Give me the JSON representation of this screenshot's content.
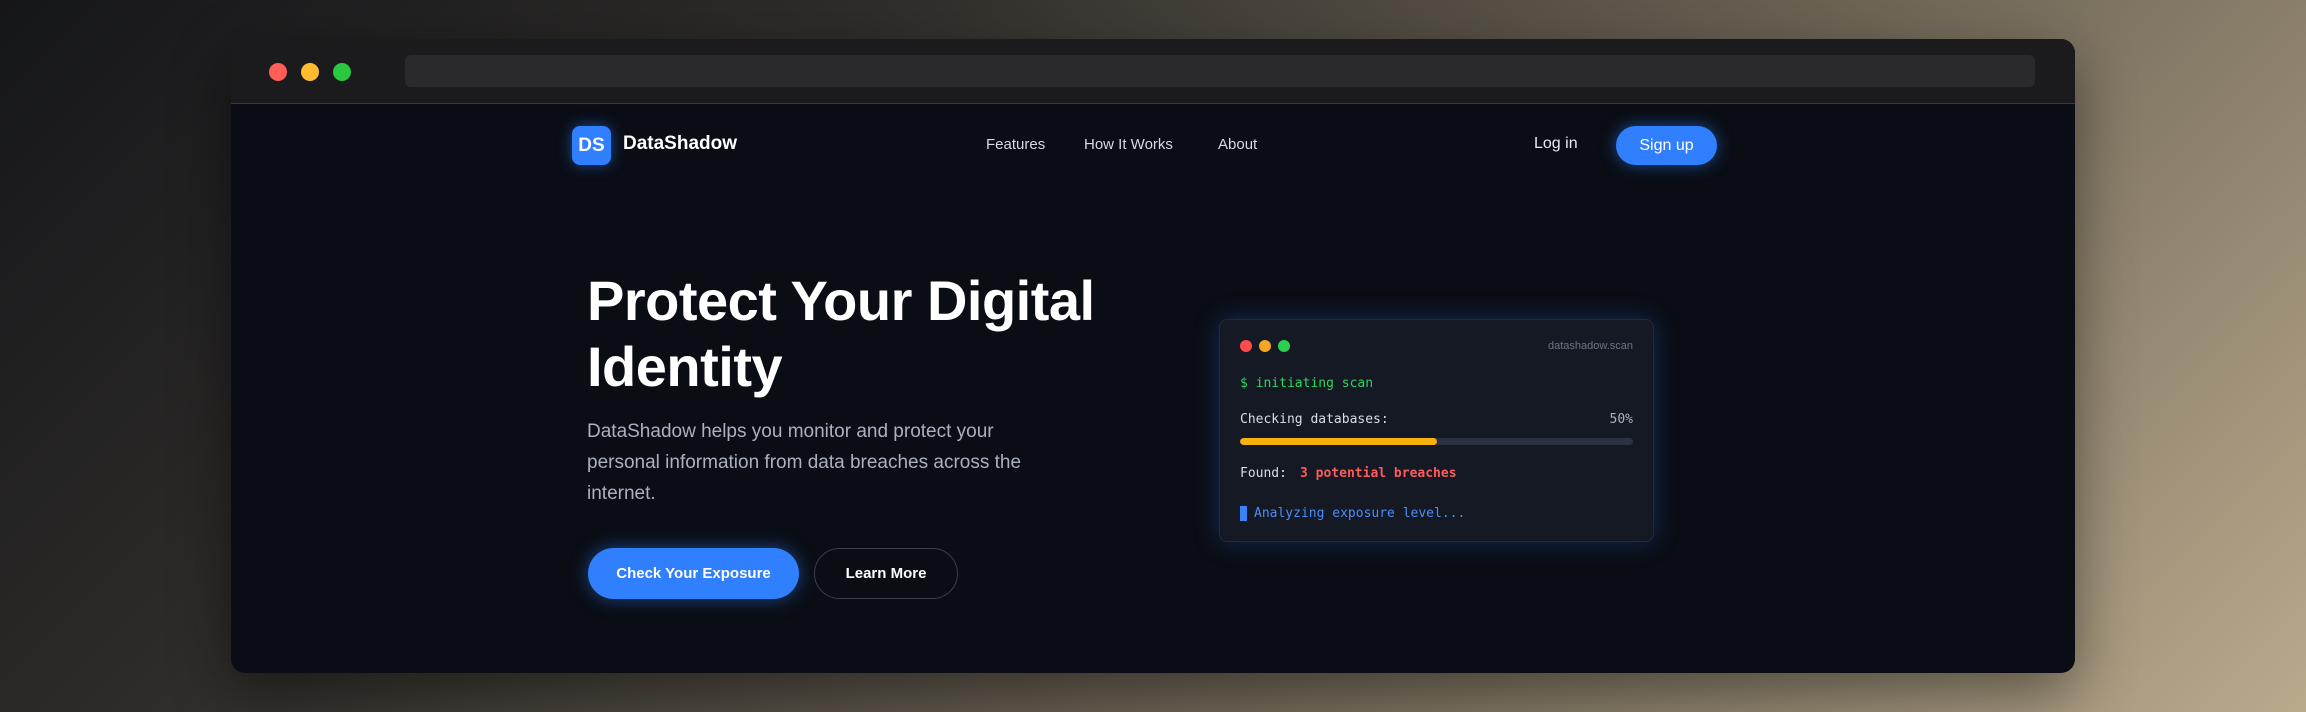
{
  "nav": {
    "logo_text": "DS",
    "brand": "DataShadow",
    "links": [
      "Features",
      "How It Works",
      "About"
    ],
    "login": "Log in",
    "signup": "Sign up"
  },
  "hero": {
    "title": "Protect Your Digital Identity",
    "description": "DataShadow helps you monitor and protect your personal information from data breaches across the internet.",
    "primary_button": "Check Your Exposure",
    "secondary_button": "Learn More"
  },
  "terminal": {
    "title": "datashadow.scan",
    "command": "$ initiating scan",
    "checking_label": "Checking databases:",
    "progress_text": "50%",
    "progress": 0.5,
    "found_label": "Found:",
    "found_value": "3 potential breaches",
    "status": "Analyzing exposure level..."
  },
  "colors": {
    "accent": "#2f7fff",
    "page_bg": "#0a0d14",
    "success": "#2bd65c",
    "danger": "#ff5a5a",
    "progress": "#f5b20f"
  }
}
